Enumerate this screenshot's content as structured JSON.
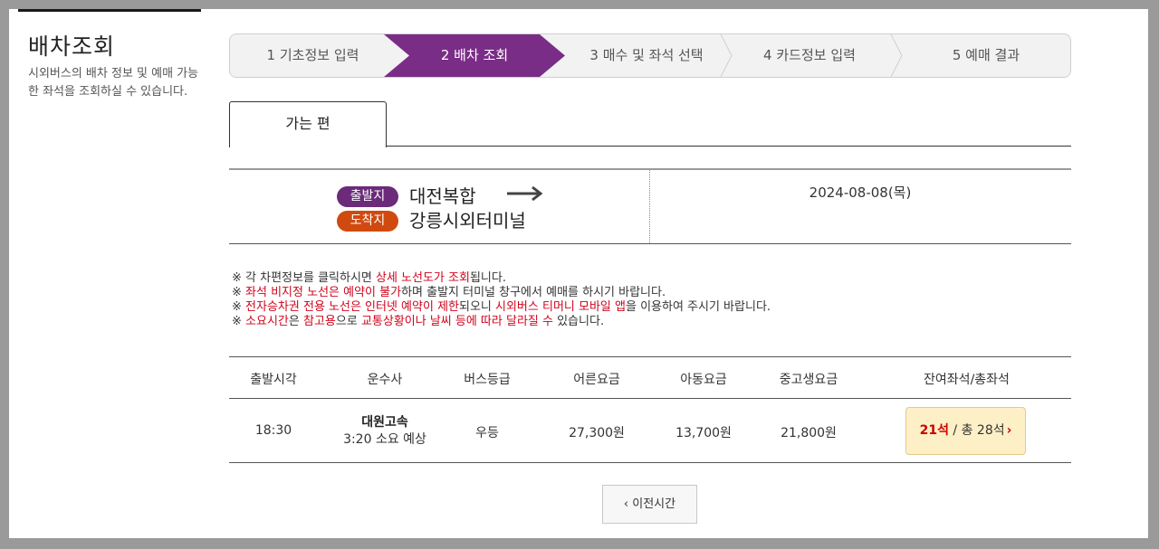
{
  "page": {
    "title": "배차조회",
    "desc": "시외버스의 배차 정보 및 예매 가능한 좌석을 조회하실 수 있습니다."
  },
  "steps": [
    {
      "label": "1 기초정보 입력"
    },
    {
      "label": "2 배차 조회"
    },
    {
      "label": "3 매수 및 좌석 선택"
    },
    {
      "label": "4 카드정보 입력"
    },
    {
      "label": "5 예매 결과"
    }
  ],
  "tabs": {
    "outbound": "가는 편"
  },
  "route": {
    "dep_badge": "출발지",
    "arr_badge": "도착지",
    "departure": "대전복합",
    "arrival": "강릉시외터미널",
    "date": "2024-08-08(목)",
    "colors": {
      "dep": "#6b2b7a",
      "arr": "#d04a10",
      "accent": "#7a2d86"
    }
  },
  "notes": {
    "mark": "※",
    "n1_a": " 각 차편정보를 클릭하시면 ",
    "n1_b": "상세 노선도가 조회",
    "n1_c": "됩니다.",
    "n2_a": "좌석 비지정 노선은 예약이 불가",
    "n2_b": "하며 출발지 터미널 창구에서 예매를 하시기 바랍니다.",
    "n3_a": "전자승차권 전용 노선은 인터넷 예약이 제한",
    "n3_b": "되오니 ",
    "n3_c": "시외버스 티머니 모바일 앱",
    "n3_d": "을 이용하여 주시기 바랍니다.",
    "n4_a": "소요시간",
    "n4_b": "은 ",
    "n4_c": "참고용",
    "n4_d": "으로 ",
    "n4_e": "교통상황이나 날씨 등에 따라 달라질 수",
    "n4_f": " 있습니다."
  },
  "table": {
    "headers": [
      "출발시각",
      "운수사",
      "버스등급",
      "어른요금",
      "아동요금",
      "중고생요금",
      "잔여좌석/총좌석"
    ],
    "rows": [
      {
        "time": "18:30",
        "company": "대원고속",
        "duration": "3:20 소요 예상",
        "grade": "우등",
        "adult": "27,300원",
        "child": "13,700원",
        "youth": "21,800원",
        "seats_remain": "21석",
        "seats_total": " / 총 28석",
        "chev": "›"
      }
    ]
  },
  "buttons": {
    "prev": "이전시간",
    "prev_chev": "‹"
  }
}
